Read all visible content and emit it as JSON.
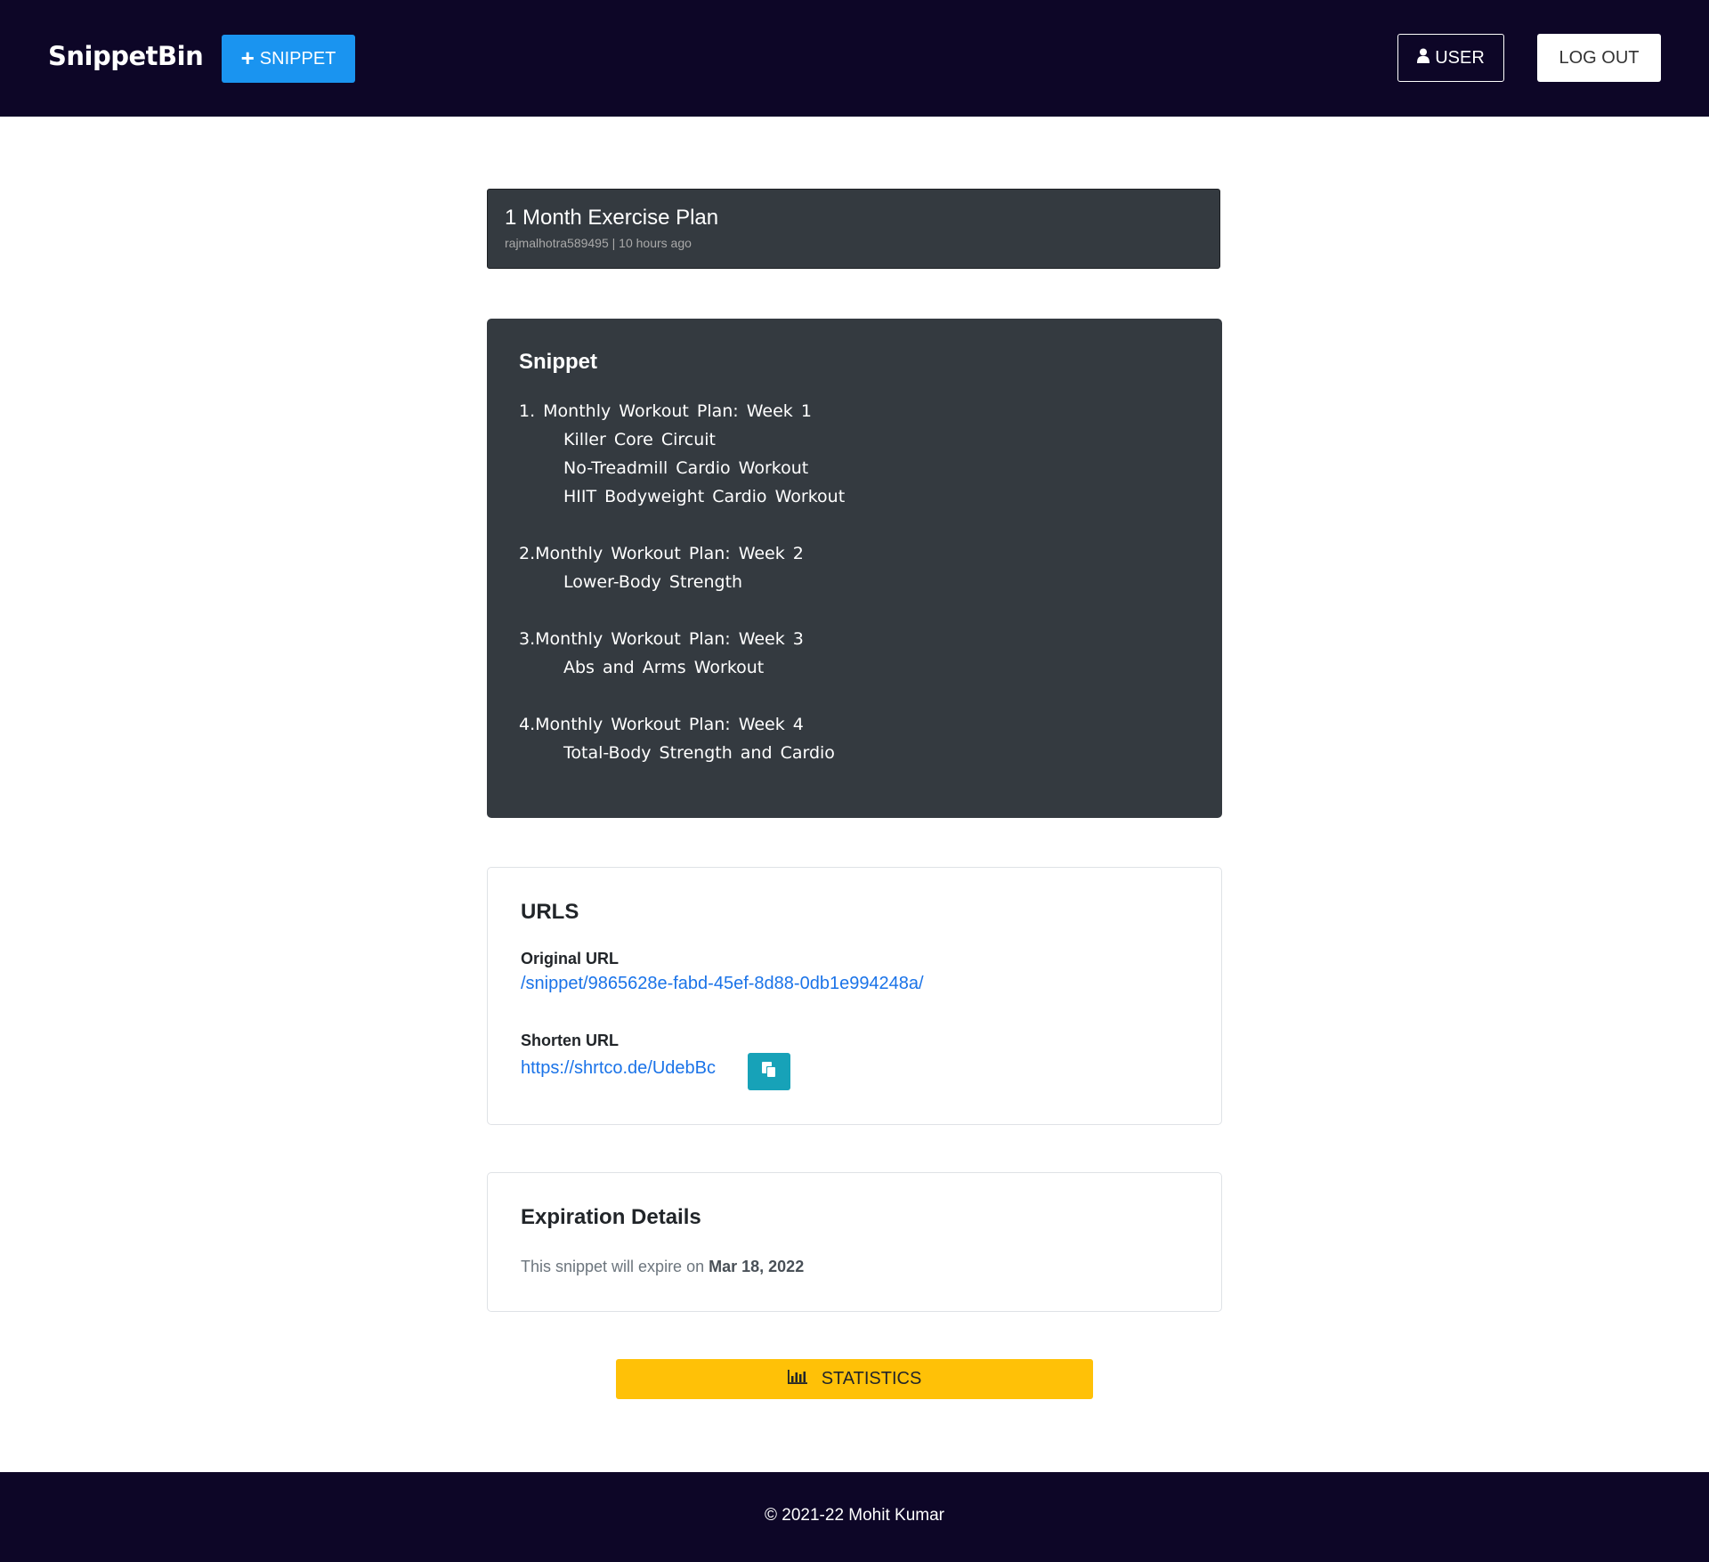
{
  "navbar": {
    "brand": "SnippetBin",
    "new_snippet_label": "SNIPPET",
    "user_label": "USER",
    "logout_label": "LOG OUT"
  },
  "snippet": {
    "title": "1 Month Exercise Plan",
    "author": "rajmalhotra589495",
    "separator": "|",
    "time_ago": "10 hours ago",
    "heading": "Snippet",
    "lines": [
      "1. Monthly Workout Plan: Week 1",
      "Killer Core Circuit",
      "No-Treadmill Cardio Workout",
      "HIIT Bodyweight Cardio Workout",
      "",
      "2.Monthly Workout Plan: Week 2",
      "Lower-Body Strength",
      "",
      "3.Monthly Workout Plan: Week 3",
      "Abs and Arms Workout",
      "",
      "4.Monthly Workout Plan: Week 4",
      "Total-Body Strength and Cardio"
    ]
  },
  "urls": {
    "heading": "URLS",
    "original_label": "Original URL",
    "original_url": "/snippet/9865628e-fabd-45ef-8d88-0db1e994248a/",
    "shorten_label": "Shorten URL",
    "shorten_url": "https://shrtco.de/UdebBc"
  },
  "expiration": {
    "heading": "Expiration Details",
    "text": "This snippet will expire on",
    "date": "Mar 18, 2022"
  },
  "actions": {
    "statistics_label": "STATISTICS"
  },
  "footer": {
    "copyright": "© 2021-22 Mohit Kumar"
  },
  "colors": {
    "navbar_bg": "#0d0627",
    "primary": "#1a94f0",
    "card_dark": "#343a40",
    "link": "#1a73e8",
    "info": "#17a2b8",
    "warning": "#ffc107"
  }
}
